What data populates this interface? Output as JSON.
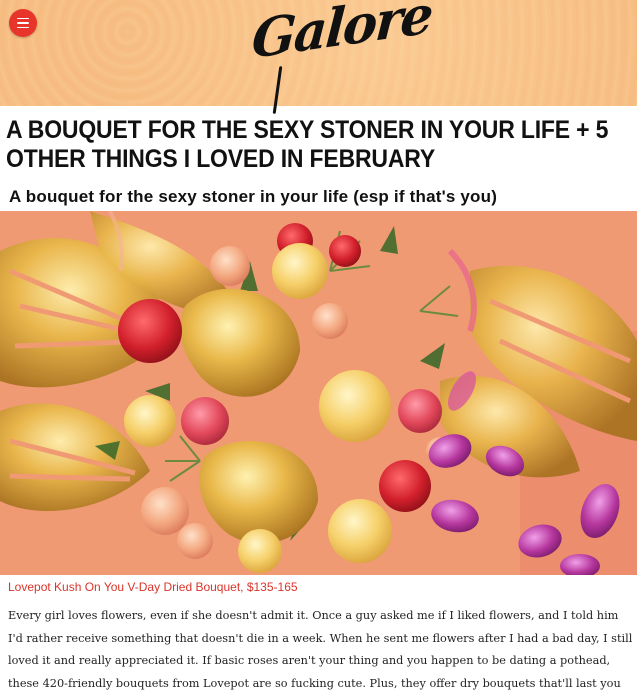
{
  "header": {
    "logo_text": "Galore",
    "menu_icon": "hamburger-menu-icon",
    "accent_color": "#e8352c",
    "background_color": "#f8c186"
  },
  "article": {
    "title": "A BOUQUET FOR THE SEXY STONER IN YOUR LIFE + 5 OTHER THINGS I LOVED IN FEBRUARY",
    "subheading": "A bouquet for the sexy stoner in your life (esp if that's you)",
    "image_caption": "Lovepot Kush On You V-Day Dried Bouquet, $135-165",
    "caption_color": "#d9352b",
    "body": "Every girl loves flowers, even if she doesn't admit it. Once a guy asked me if I liked flowers, and I told him I'd rather receive something that doesn't die in a week. When he sent me flowers after I had a bad day, I still loved it and really appreciated it. If basic roses aren't your thing and you happen to be dating a pothead, these 420-friendly bouquets from Lovepot are so fucking cute. Plus, they offer dry bouquets that'll last you forever!"
  }
}
